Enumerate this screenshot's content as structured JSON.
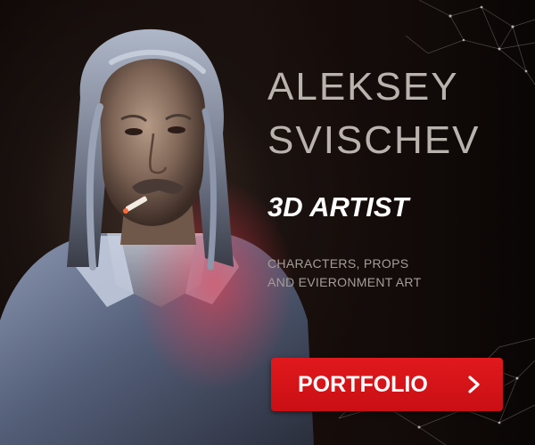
{
  "artist": {
    "first_name": "ALEKSEY",
    "last_name": "SVISCHEV",
    "role": "3D ARTIST",
    "specialty_line_1": "CHARACTERS, PROPS",
    "specialty_line_2": "AND EVIERONMENT ART"
  },
  "cta": {
    "label": "PORTFOLIO",
    "icon": "chevron-right-icon"
  },
  "colors": {
    "background": "#0b0706",
    "name_text": "#b9b3ad",
    "role_text": "#ffffff",
    "specialty_text": "#a59e97",
    "cta_background": "#d7161b",
    "cta_text": "#ffffff"
  }
}
